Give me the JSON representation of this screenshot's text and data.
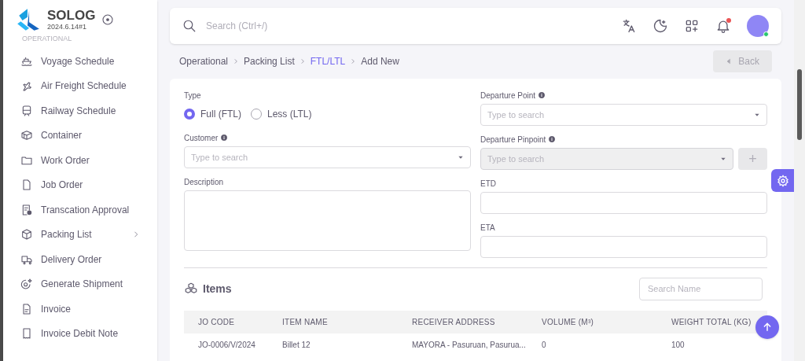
{
  "sidebar": {
    "title": "SOLOG",
    "version": "2024.6.14#1",
    "section": "OPERATIONAL",
    "items": [
      {
        "label": "Voyage Schedule",
        "expandable": false
      },
      {
        "label": "Air Freight Schedule",
        "expandable": false
      },
      {
        "label": "Railway Schedule",
        "expandable": false
      },
      {
        "label": "Container",
        "expandable": false
      },
      {
        "label": "Work Order",
        "expandable": false
      },
      {
        "label": "Job Order",
        "expandable": false
      },
      {
        "label": "Transcation Approval",
        "expandable": false
      },
      {
        "label": "Packing List",
        "expandable": true
      },
      {
        "label": "Delivery Order",
        "expandable": false
      },
      {
        "label": "Generate Shipment",
        "expandable": false
      },
      {
        "label": "Invoice",
        "expandable": false
      },
      {
        "label": "Invoice Debit Note",
        "expandable": false
      }
    ]
  },
  "topbar": {
    "search_placeholder": "Search (Ctrl+/)",
    "notification_badge": true,
    "user_online": true
  },
  "breadcrumb": [
    {
      "label": "Operational",
      "selected": false
    },
    {
      "label": "Packing List",
      "selected": false
    },
    {
      "label": "FTL/LTL",
      "selected": true
    },
    {
      "label": "Add New",
      "selected": false
    }
  ],
  "back_button": {
    "label": "Back",
    "disabled": true
  },
  "form": {
    "left": [
      {
        "kind": "radio",
        "label": "Type",
        "info": false,
        "options": [
          {
            "label": "Full (FTL)",
            "selected": true
          },
          {
            "label": "Less (LTL)",
            "selected": false
          }
        ]
      },
      {
        "kind": "select",
        "label": "Customer",
        "info": true,
        "placeholder": "Type to search",
        "disabled": false
      },
      {
        "kind": "textarea",
        "label": "Description",
        "info": false
      }
    ],
    "right": [
      {
        "kind": "select",
        "label": "Departure Point",
        "info": true,
        "placeholder": "Type to search",
        "disabled": false
      },
      {
        "kind": "select",
        "label": "Departure Pinpoint",
        "info": true,
        "placeholder": "Type to search",
        "disabled": true,
        "add_button": "+"
      },
      {
        "kind": "input",
        "label": "ETD",
        "info": false
      },
      {
        "kind": "input",
        "label": "ETA",
        "info": false
      }
    ]
  },
  "items": {
    "title": "Items",
    "search_placeholder": "Search Name",
    "columns": [
      "JO CODE",
      "ITEM NAME",
      "RECEIVER ADDRESS",
      "VOLUME (M³)",
      "WEIGHT TOTAL (KG)"
    ],
    "rows": [
      [
        "JO-0006/V/2024",
        "Billet 12",
        "MAYORA - Pasuruan, Pasurua...",
        "0",
        "100"
      ]
    ]
  }
}
